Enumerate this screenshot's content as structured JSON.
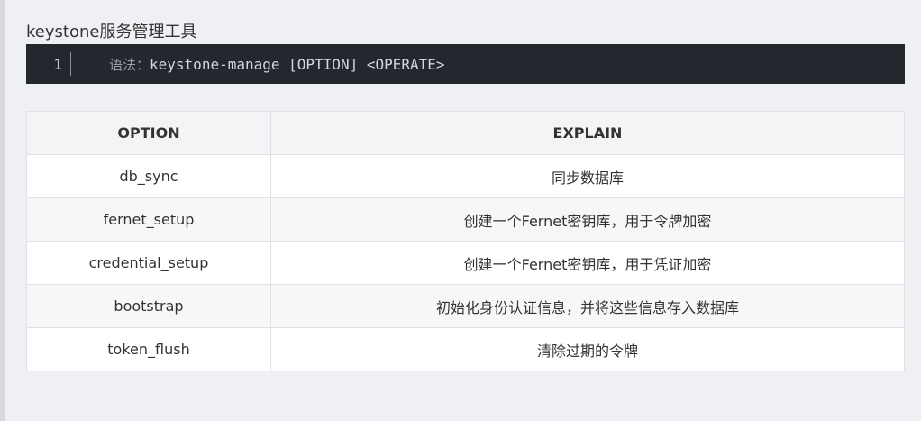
{
  "heading": "keystone服务管理工具",
  "code": {
    "line_number": "1",
    "prefix": "语法：",
    "text": "keystone-manage [OPTION] <OPERATE>"
  },
  "table": {
    "headers": [
      "OPTION",
      "EXPLAIN"
    ],
    "rows": [
      {
        "option": "db_sync",
        "explain": "同步数据库"
      },
      {
        "option": "fernet_setup",
        "explain": "创建一个Fernet密钥库，用于令牌加密"
      },
      {
        "option": "credential_setup",
        "explain": "创建一个Fernet密钥库，用于凭证加密"
      },
      {
        "option": "bootstrap",
        "explain": "初始化身份认证信息，并将这些信息存入数据库"
      },
      {
        "option": "token_flush",
        "explain": "清除过期的令牌"
      }
    ]
  }
}
